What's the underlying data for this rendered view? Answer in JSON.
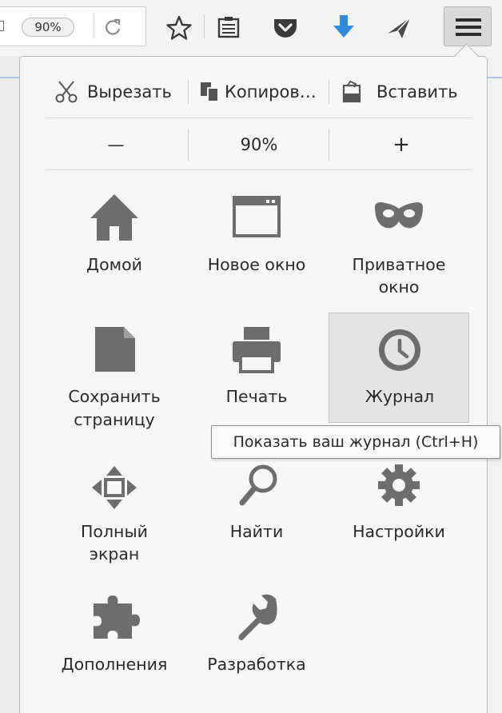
{
  "toolbar": {
    "zoom_value": "90%",
    "icons": [
      "page-icon",
      "reload-icon",
      "bookmark-star-icon",
      "reading-list-icon",
      "pocket-icon",
      "downloads-arrow-icon",
      "send-paper-plane-icon",
      "hamburger-menu-icon"
    ],
    "accent_color": "#2f8ad8"
  },
  "edit_controls": {
    "cut": "Вырезать",
    "copy": "Копиров…",
    "paste": "Вставить"
  },
  "zoom_controls": {
    "zoom_out": "—",
    "level": "90%",
    "zoom_in": "+"
  },
  "menu": {
    "home": "Домой",
    "new_window_label": "Новое окно",
    "private_window_line1": "Приватное",
    "private_window_line2": "окно",
    "save_page_line1": "Сохранить",
    "save_page_line2": "страницу",
    "print": "Печать",
    "history": "Журнал",
    "fullscreen_line1": "Полный",
    "fullscreen_line2": "экран",
    "find": "Найти",
    "settings": "Настройки",
    "addons": "Дополнения",
    "developer": "Разработка"
  },
  "tooltip": {
    "text": "Показать ваш журнал (Ctrl+H)"
  },
  "colors": {
    "icon_gray": "#6d6d6d",
    "selected_tile": "#e4e4e4"
  }
}
